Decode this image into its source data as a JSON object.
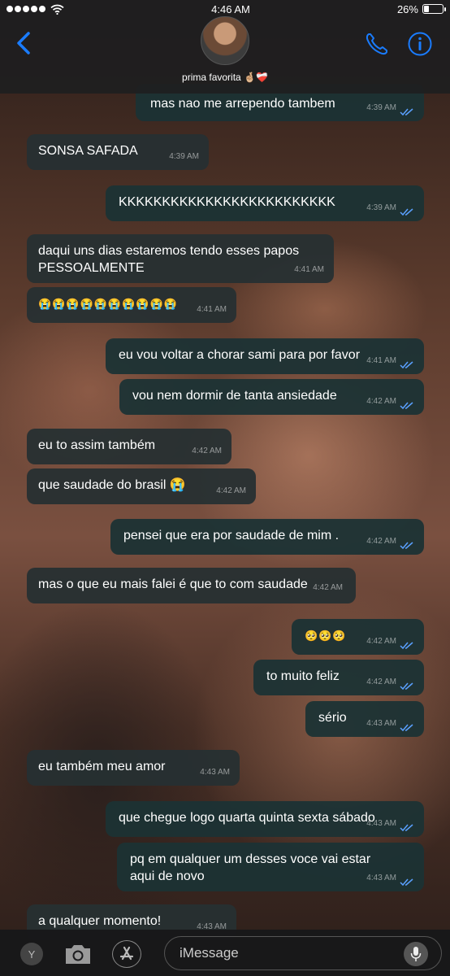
{
  "status_bar": {
    "time": "4:46 AM",
    "battery": "26%",
    "battery_level": 0.26
  },
  "header": {
    "contact_name": "prima favorita 🤞🏼❤️‍🩹"
  },
  "messages": [
    {
      "text": "mas nao me arrependo tambem",
      "time": "4:39 AM",
      "dir": "out"
    },
    {
      "text": "SONSA SAFADA",
      "time": "4:39 AM",
      "dir": "in"
    },
    {
      "text": "KKKKKKKKKKKKKKKKKKKKKKKKK",
      "time": "4:39 AM",
      "dir": "out"
    },
    {
      "text": "daqui uns dias estaremos tendo esses papos PESSOALMENTE",
      "time": "4:41 AM",
      "dir": "in"
    },
    {
      "text": "😭😭😭😭😭😭😭😭😭😭",
      "time": "4:41 AM",
      "dir": "in"
    },
    {
      "text": "eu vou voltar a chorar sami para por favor",
      "time": "4:41 AM",
      "dir": "out"
    },
    {
      "text": "vou nem dormir de tanta ansiedade",
      "time": "4:42 AM",
      "dir": "out"
    },
    {
      "text": "eu to assim também",
      "time": "4:42 AM",
      "dir": "in"
    },
    {
      "text": "que saudade do brasil 😭",
      "time": "4:42 AM",
      "dir": "in"
    },
    {
      "text": "pensei que era por saudade de mim .",
      "time": "4:42 AM",
      "dir": "out"
    },
    {
      "text": "mas o que eu mais falei é que to com saudade",
      "time": "4:42 AM",
      "dir": "in"
    },
    {
      "text": "🥺🥺🥺",
      "time": "4:42 AM",
      "dir": "out"
    },
    {
      "text": "to muito feliz",
      "time": "4:42 AM",
      "dir": "out"
    },
    {
      "text": "sério",
      "time": "4:43 AM",
      "dir": "out"
    },
    {
      "text": "eu também meu amor",
      "time": "4:43 AM",
      "dir": "in"
    },
    {
      "text": "que chegue logo quarta quinta sexta sábado",
      "time": "4:43 AM",
      "dir": "out"
    },
    {
      "text": "pq em qualquer um desses voce vai estar aqui de novo",
      "time": "4:43 AM",
      "dir": "out"
    },
    {
      "text": "a qualquer momento!",
      "time": "4:43 AM",
      "dir": "in"
    }
  ],
  "composer": {
    "placeholder": "iMessage",
    "y_label": "Y"
  },
  "colors": {
    "accent": "#1a7cff",
    "ticks": "#5aa0ff"
  },
  "icons": [
    "back-chevron-icon",
    "phone-icon",
    "info-icon",
    "camera-icon",
    "appstore-icon",
    "microphone-icon",
    "wifi-icon",
    "battery-icon"
  ]
}
